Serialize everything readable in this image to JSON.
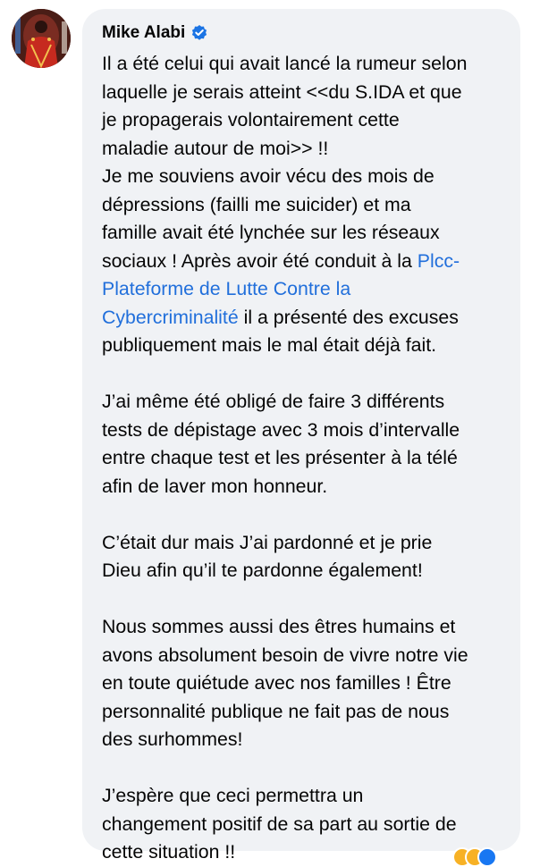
{
  "comment": {
    "author": {
      "name": "Mike Alabi",
      "verified": true,
      "verified_color": "#1b74e4"
    },
    "paragraphs": [
      {
        "lines": [
          "Il a été celui qui avait lancé la rumeur selon",
          "laquelle je serais atteint <<du S.IDA et que",
          "je propagerais volontairement cette",
          "maladie autour de moi>> !!",
          "Je me souviens avoir vécu des mois de",
          "dépressions (failli me suicider) et ma",
          "famille avait été lynchée sur les réseaux"
        ],
        "line8_text": "sociaux ! Après avoir été conduit à la ",
        "line8_link": "Plcc-",
        "line9_link": "Plateforme de Lutte Contre la",
        "line10_link": "Cybercriminalité",
        "line10_text": " il a présenté des excuses",
        "line11_text": "publiquement mais le mal était déjà fait."
      },
      {
        "lines": [
          "J’ai même été obligé de faire 3 différents",
          "tests de dépistage avec 3 mois d’intervalle",
          "entre chaque test et les présenter à la télé",
          "afin de laver mon honneur."
        ]
      },
      {
        "lines": [
          "C’était dur mais J’ai pardonné et je prie",
          "Dieu afin qu’il te pardonne également!"
        ]
      },
      {
        "lines": [
          "Nous sommes aussi des êtres humains et",
          "avons absolument besoin de vivre notre vie",
          "en toute quiétude avec nos familles ! Être",
          "personnalité publique ne fait pas de nous",
          "des surhommes!"
        ]
      },
      {
        "lines": [
          "J’espère que ceci permettra un",
          "changement positif de sa part au sortie de",
          "cette situation !!"
        ]
      }
    ],
    "link_color": "#216fdb",
    "bubble_color": "#f0f2f5",
    "reaction_icons": [
      "haha-icon",
      "care-icon",
      "like-icon"
    ]
  }
}
